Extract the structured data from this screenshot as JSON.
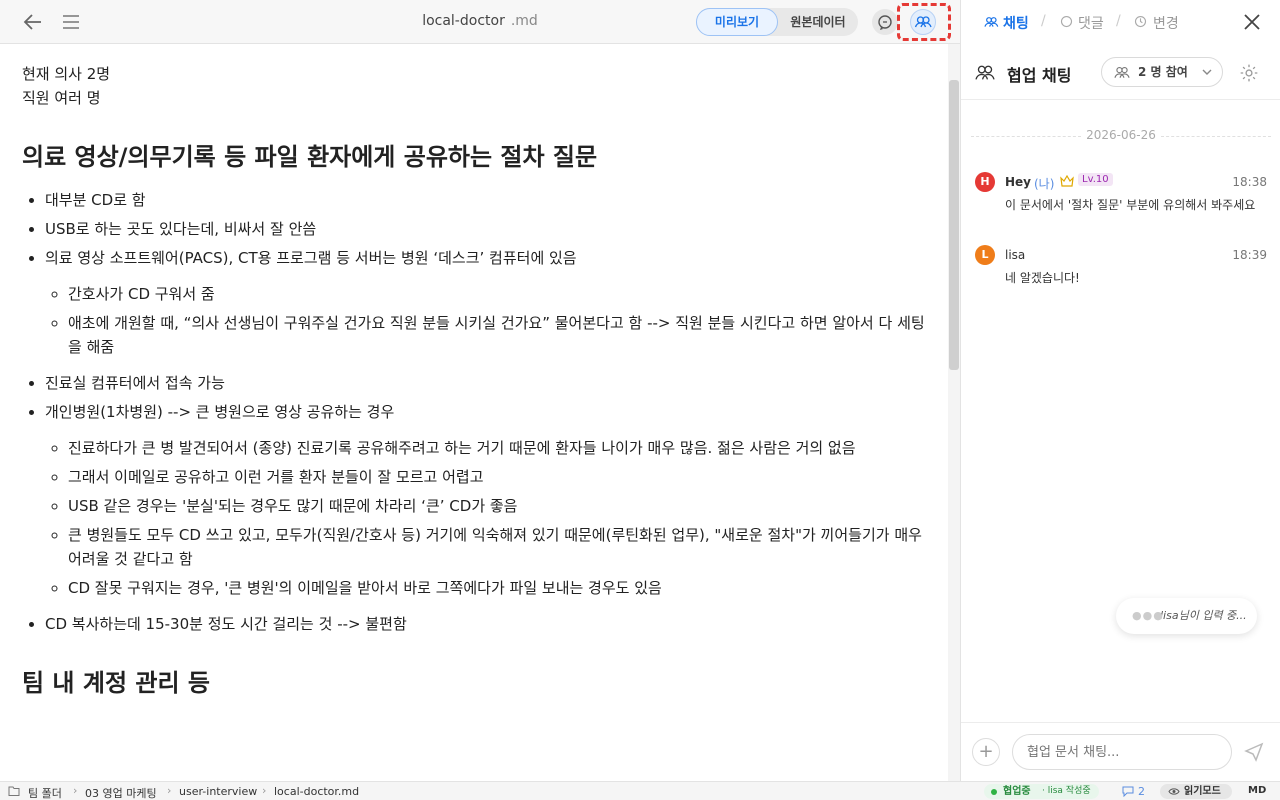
{
  "header": {
    "filename": "local-doctor",
    "extension": ".md",
    "view_modes": [
      "미리보기",
      "원본데이터"
    ]
  },
  "document": {
    "intro": [
      "현재 의사 2명",
      "직원 여러 명"
    ],
    "section1": {
      "title": "의료 영상/의무기록 등 파일 환자에게 공유하는 절차 질문",
      "bullets_a": [
        "대부분 CD로 함",
        "USB로 하는 곳도 있다는데, 비싸서 잘 안씀",
        "의료 영상 소프트웨어(PACS), CT용 프로그램 등 서버는 병원 ‘데스크’ 컴퓨터에 있음"
      ],
      "sub_a": [
        "간호사가 CD 구워서 줌",
        "애초에 개원할 때, “의사 선생님이 구워주실 건가요 직원 분들 시키실 건가요” 물어본다고 함 --> 직원 분들 시킨다고 하면 알아서 다 세팅을 해줌"
      ],
      "bullets_b": [
        "진료실 컴퓨터에서 접속 가능",
        "개인병원(1차병원) --> 큰 병원으로 영상 공유하는 경우"
      ],
      "sub_b": [
        "진료하다가 큰 병 발견되어서 (종양) 진료기록 공유해주려고 하는 거기 때문에 환자들 나이가 매우 많음. 젊은 사람은 거의 없음",
        "그래서 이메일로 공유하고 이런 거를 환자 분들이 잘 모르고 어렵고",
        "USB 같은 경우는 '분실'되는 경우도 많기 때문에 차라리 ‘큰’ CD가 좋음",
        "큰 병원들도 모두 CD 쓰고 있고, 모두가(직원/간호사 등) 거기에 익숙해져 있기 때문에(루틴화된 업무), \"새로운 절차\"가 끼어들기가 매우 어려울 것 같다고 함",
        "CD 잘못 구워지는 경우, '큰 병원'의 이메일을 받아서 바로 그쪽에다가 파일 보내는 경우도 있음"
      ],
      "bullets_c": [
        "CD 복사하는데 15-30분 정도 시간 걸리는 것 --> 불편함"
      ]
    },
    "section2": {
      "title": "팀 내 계정 관리 등"
    }
  },
  "panel": {
    "tabs": [
      "채팅",
      "댓글",
      "변경"
    ],
    "chat_title": "협업 채팅",
    "participants": "2 명 참여",
    "date": "2026-06-26",
    "messages": [
      {
        "initial": "H",
        "name": "Hey",
        "me": "(나)",
        "level": "Lv.10",
        "time": "18:38",
        "text": "이 문서에서 '절차 질문' 부분에 유의해서 봐주세요",
        "color": "#e53935"
      },
      {
        "initial": "L",
        "name": "lisa",
        "time": "18:39",
        "text": "네 알겠습니다!",
        "color": "#ef7d1a"
      }
    ],
    "typing": "lisa님이 입력 중...",
    "input_placeholder": "협업 문서 채팅..."
  },
  "statusbar": {
    "breadcrumb": [
      "팀 폴더",
      "03 영업 마케팅",
      "user-interview",
      "local-doctor.md"
    ],
    "collab": "협업중",
    "writing": "· lisa 작성중",
    "comments": "2",
    "read_mode": "읽기모드",
    "format": "MD"
  },
  "colors": {
    "accent": "#1a73e8",
    "online": "#2fb344",
    "highlight": "#e53935"
  }
}
